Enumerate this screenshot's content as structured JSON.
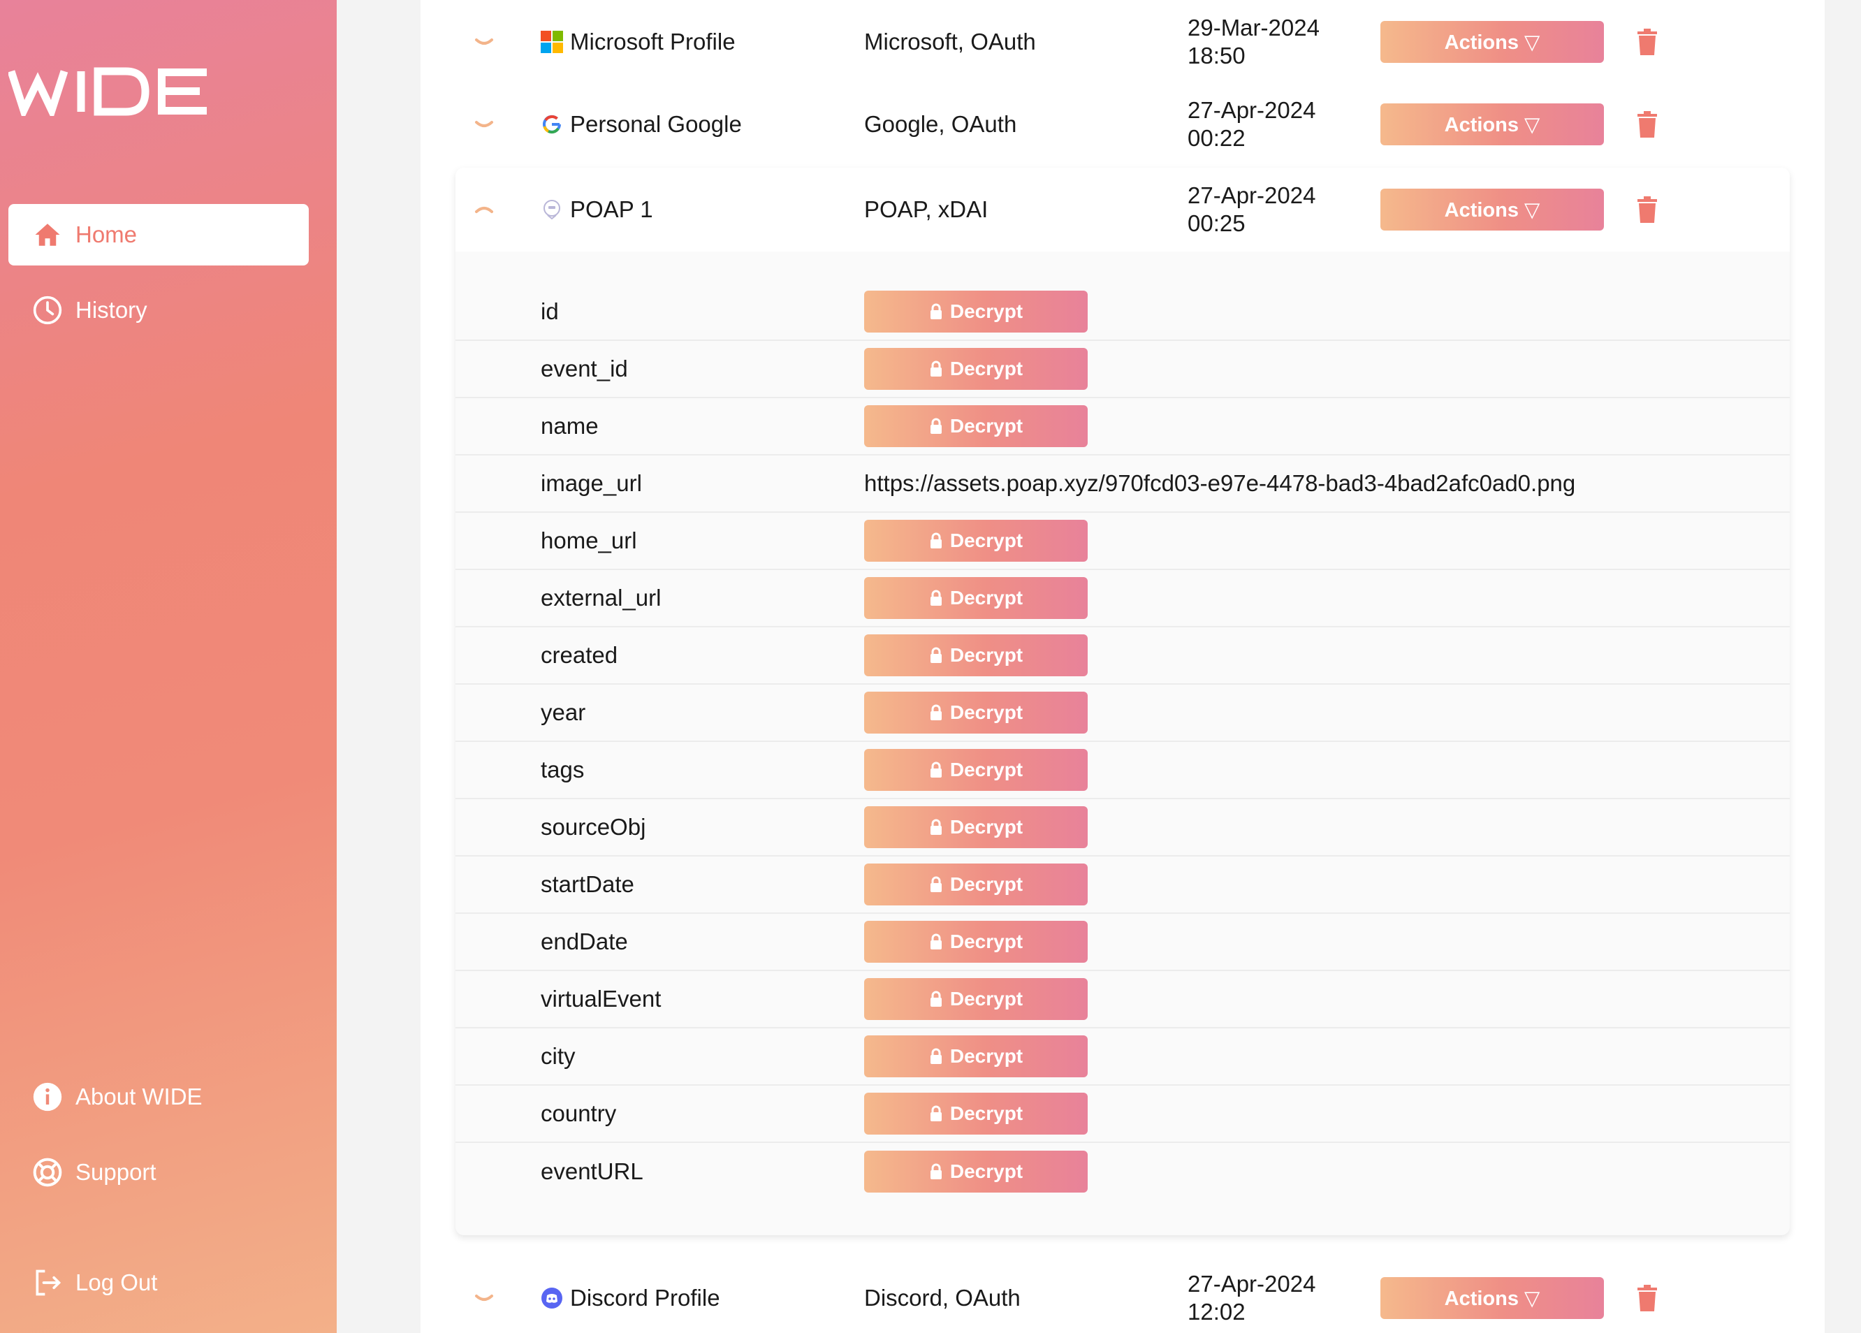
{
  "sidebar": {
    "logo_text": "WIDE",
    "nav": [
      {
        "label": "Home",
        "icon": "home-icon",
        "active": true
      },
      {
        "label": "History",
        "icon": "clock-icon",
        "active": false
      },
      {
        "label": "About WIDE",
        "icon": "info-icon",
        "active": false
      },
      {
        "label": "Support",
        "icon": "lifebuoy-icon",
        "active": false
      },
      {
        "label": "Log Out",
        "icon": "logout-icon",
        "active": false
      }
    ]
  },
  "credentials": [
    {
      "name": "Microsoft Profile",
      "type": "Microsoft, OAuth",
      "date": "29-Mar-2024",
      "time": "18:50",
      "icon": "microsoft-icon",
      "actions_label": "Actions ▽"
    },
    {
      "name": "Personal Google",
      "type": "Google, OAuth",
      "date": "27-Apr-2024",
      "time": "00:22",
      "icon": "google-icon",
      "actions_label": "Actions ▽"
    },
    {
      "name": "POAP 1",
      "type": "POAP, xDAI",
      "date": "27-Apr-2024",
      "time": "00:25",
      "icon": "poap-icon",
      "actions_label": "Actions ▽",
      "expanded": true
    },
    {
      "name": "Discord Profile",
      "type": "Discord, OAuth",
      "date": "27-Apr-2024",
      "time": "12:02",
      "icon": "discord-icon",
      "actions_label": "Actions ▽"
    }
  ],
  "poap_fields": [
    {
      "name": "id",
      "button": "Decrypt"
    },
    {
      "name": "event_id",
      "button": "Decrypt"
    },
    {
      "name": "name",
      "button": "Decrypt"
    },
    {
      "name": "image_url",
      "value": "https://assets.poap.xyz/970fcd03-e97e-4478-bad3-4bad2afc0ad0.png"
    },
    {
      "name": "home_url",
      "button": "Decrypt"
    },
    {
      "name": "external_url",
      "button": "Decrypt"
    },
    {
      "name": "created",
      "button": "Decrypt"
    },
    {
      "name": "year",
      "button": "Decrypt"
    },
    {
      "name": "tags",
      "button": "Decrypt"
    },
    {
      "name": "sourceObj",
      "button": "Decrypt"
    },
    {
      "name": "startDate",
      "button": "Decrypt"
    },
    {
      "name": "endDate",
      "button": "Decrypt"
    },
    {
      "name": "virtualEvent",
      "button": "Decrypt"
    },
    {
      "name": "city",
      "button": "Decrypt"
    },
    {
      "name": "country",
      "button": "Decrypt"
    },
    {
      "name": "eventURL",
      "button": "Decrypt"
    }
  ],
  "colors": {
    "accent": "#ef7a6f",
    "button_start": "#f5b98c",
    "button_end": "#e8829a",
    "trash": "#ef7a6f"
  }
}
